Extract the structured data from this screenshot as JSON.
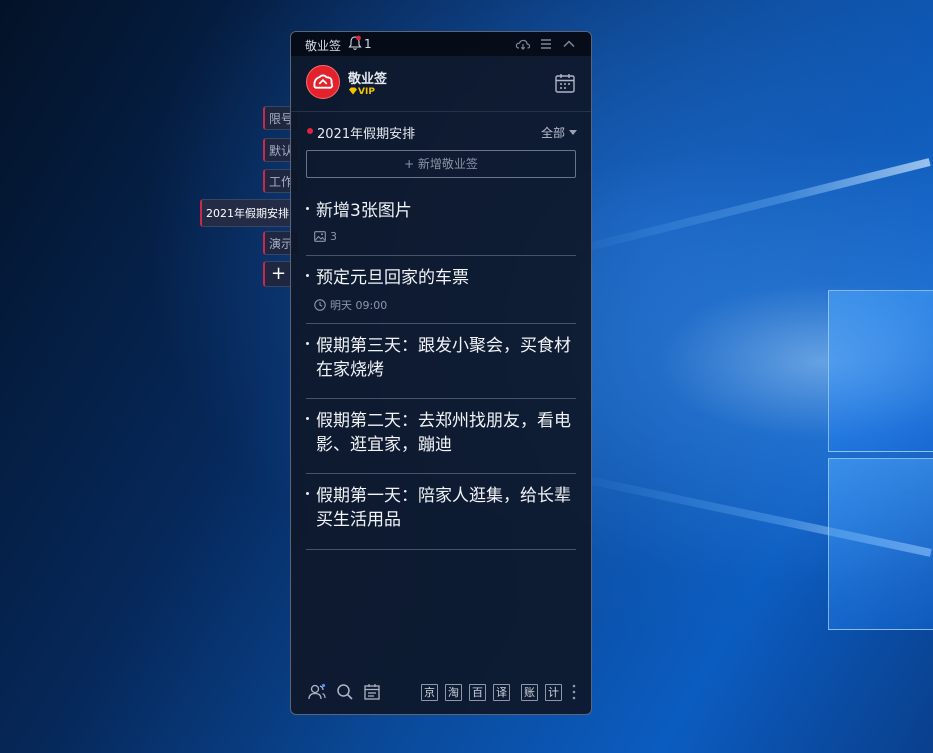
{
  "window": {
    "title": "敬业签",
    "reminder_count": "1"
  },
  "header": {
    "app_name": "敬业签",
    "vip_badge": "VIP"
  },
  "side_tabs": [
    {
      "label": "限号"
    },
    {
      "label": "默认"
    },
    {
      "label": "工作"
    },
    {
      "label": "2021年假期安排",
      "active": true
    },
    {
      "label": "演示"
    }
  ],
  "side_add_label": "+",
  "category": {
    "title": "2021年假期安排",
    "filter": "全部",
    "dot_color": "#e0243f"
  },
  "add_note_label": "+ 新增敬业签",
  "notes": [
    {
      "text": "新增3张图片",
      "meta": "3",
      "meta_icon": "image-icon"
    },
    {
      "text": "预定元旦回家的车票",
      "meta": "明天 09:00",
      "meta_icon": "clock-icon"
    },
    {
      "text": "假期第三天：跟发小聚会，买食材在家烧烤"
    },
    {
      "text": "假期第二天：去郑州找朋友，看电影、逛宜家，蹦迪"
    },
    {
      "text": "假期第一天：陪家人逛集，给长辈买生活用品"
    }
  ],
  "shortcuts": [
    "京",
    "淘",
    "百",
    "译",
    "账",
    "计"
  ],
  "colors": {
    "accent_red": "#e2232e",
    "vip_gold": "#f2c400",
    "panel_bg": "#0e182a"
  }
}
